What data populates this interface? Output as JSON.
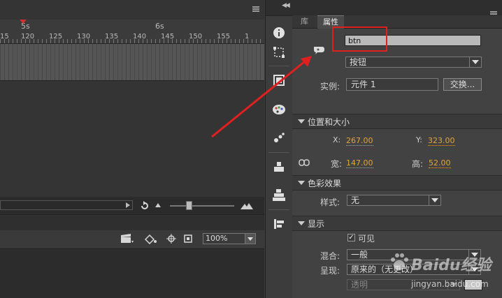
{
  "timeline": {
    "second_markers": [
      "5s",
      "6s"
    ],
    "frame_numbers": [
      "15",
      "120",
      "125",
      "130",
      "135",
      "140",
      "145",
      "150",
      "155",
      "1"
    ],
    "zoom": "100%"
  },
  "panel": {
    "tabs": [
      {
        "label": "库",
        "active": false
      },
      {
        "label": "属性",
        "active": true
      }
    ],
    "instance_name": "btn",
    "symbol_type": "按钮",
    "instance_label": "实例:",
    "instance_value": "元件 1",
    "swap_label": "交换...",
    "position_size": {
      "title": "位置和大小",
      "x_label": "X:",
      "x": "267.00",
      "y_label": "Y:",
      "y": "323.00",
      "w_label": "宽:",
      "w": "147.00",
      "h_label": "高:",
      "h": "52.00"
    },
    "color_effect": {
      "title": "色彩效果",
      "style_label": "样式:",
      "style_value": "无"
    },
    "display": {
      "title": "显示",
      "visible_label": "可见",
      "visible_checked": true,
      "blend_label": "混合:",
      "blend_value": "一般",
      "render_label": "呈现:",
      "render_value": "原来的（无更改）",
      "transparent_label": "透明"
    }
  },
  "icons": {
    "strip": [
      "info-icon",
      "transform-icon",
      "library-icon",
      "color-palette-icon",
      "motion-presets-icon",
      "align-icon",
      "components-icon",
      "history-icon"
    ],
    "timeline": [
      "loop-icon",
      "mountain-small-icon",
      "mountain-large-icon",
      "clapper-icon",
      "paint-bucket-icon",
      "snap-icon",
      "fit-icon"
    ]
  },
  "annotation": {
    "highlight_color": "#e02020",
    "watermark": "Baidu经验",
    "watermark_url": "jingyan.baidu.com"
  }
}
